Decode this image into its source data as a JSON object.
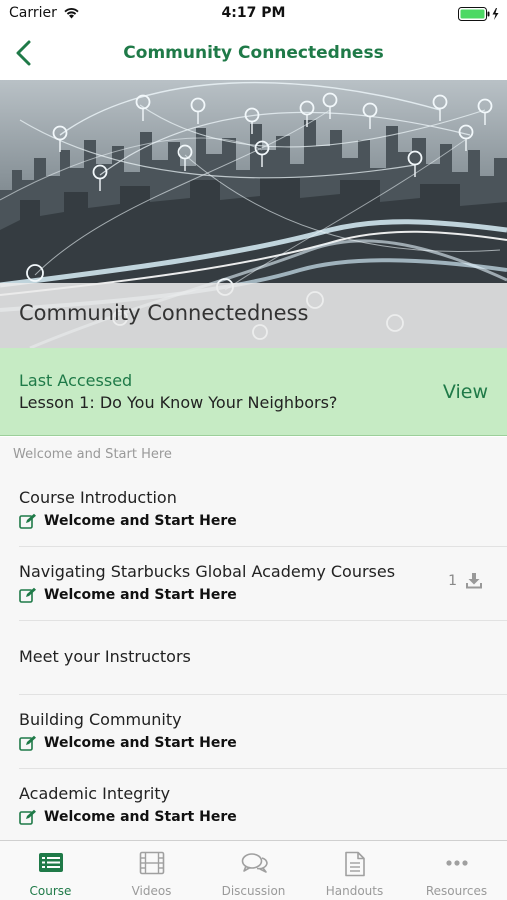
{
  "status_bar": {
    "carrier": "Carrier",
    "time": "4:17 PM"
  },
  "nav": {
    "title": "Community Connectedness",
    "back_icon": "chevron-left-icon"
  },
  "hero": {
    "title": "Community Connectedness"
  },
  "last_accessed": {
    "label": "Last Accessed",
    "lesson": "Lesson 1: Do You Know Your Neighbors?",
    "view_label": "View"
  },
  "section_header": "Welcome and Start Here",
  "items": [
    {
      "title": "Course Introduction",
      "subtitle": "Welcome and Start Here"
    },
    {
      "title": "Navigating Starbucks Global Academy Courses",
      "subtitle": "Welcome and Start Here",
      "download_count": "1"
    },
    {
      "title": "Meet your Instructors"
    },
    {
      "title": "Building Community",
      "subtitle": "Welcome and Start Here"
    },
    {
      "title": "Academic Integrity",
      "subtitle": "Welcome and Start Here"
    }
  ],
  "tabs": [
    {
      "label": "Course",
      "icon": "list-icon",
      "active": true
    },
    {
      "label": "Videos",
      "icon": "film-icon",
      "active": false
    },
    {
      "label": "Discussion",
      "icon": "chat-bubbles-icon",
      "active": false
    },
    {
      "label": "Handouts",
      "icon": "document-icon",
      "active": false
    },
    {
      "label": "Resources",
      "icon": "more-dots-icon",
      "active": false
    }
  ],
  "colors": {
    "brand_green": "#1f7a48",
    "highlight_green": "#c6ebc4",
    "battery_green": "#4cd964"
  }
}
